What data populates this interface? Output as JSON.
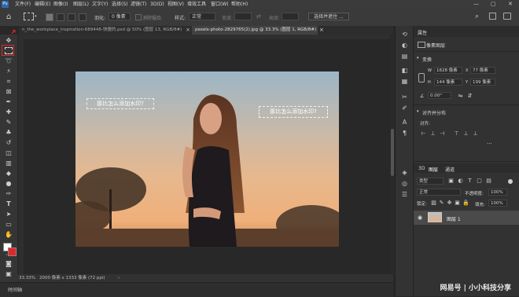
{
  "app": {
    "logo": "Ps"
  },
  "menu": [
    "文件(F)",
    "编辑(E)",
    "图像(I)",
    "图层(L)",
    "文字(Y)",
    "选择(S)",
    "滤镜(T)",
    "3D(D)",
    "视图(V)",
    "增效工具",
    "窗口(W)",
    "帮助(H)"
  ],
  "window_controls": {
    "minimize": "—",
    "maximize": "▢",
    "close": "✕"
  },
  "options": {
    "feather_label": "羽化:",
    "feather_value": "0 像素",
    "antialias_label": "消除锯齿",
    "style_label": "样式:",
    "style_value": "正常",
    "width_label": "宽度:",
    "height_label": "高度:",
    "select_mask_button": "选择并遮住 ..."
  },
  "tabs": [
    {
      "label": "n_the_workplace_inspiration-689448-快捷的.psd @ 50% (图层 13, RGB/8#)",
      "active": false,
      "close": "×"
    },
    {
      "label": "pexels-photo-2829765(2).jpg @ 33.3% (图层 1, RGB/8#)",
      "active": true,
      "close": "×"
    }
  ],
  "canvas": {
    "selection_text_1": "那比怎么添加水印?",
    "selection_text_2": "那比怎么添加水印?"
  },
  "status": {
    "zoom": "33.33%",
    "doc_info": "2000 像素 x 1333 像素 (72 ppi)",
    "arrow": "›"
  },
  "timeline": {
    "label": "时间轴"
  },
  "properties": {
    "panel_title": "属性",
    "pixel_layer_label": "像素图层",
    "transform_title": "变换",
    "w_label": "W",
    "w_value": "1828 像素",
    "x_label": "X",
    "x_value": "77 像素",
    "h_label": "H",
    "h_value": "144 像素",
    "y_label": "Y",
    "y_value": "199 像素",
    "angle_value": "0.00°",
    "align_title": "对齐并分布",
    "align_to_label": "对齐:"
  },
  "layers": {
    "tabs": [
      "3D",
      "图层",
      "通道"
    ],
    "filter_label": "类型",
    "blend_mode": "正常",
    "opacity_label": "不透明度:",
    "opacity_value": "100%",
    "lock_label": "锁定:",
    "fill_label": "填充:",
    "fill_value": "100%",
    "items": [
      {
        "name": "图层 1",
        "visible": true
      }
    ]
  },
  "watermark": "网易号 | 小小科技分享",
  "colors": {
    "accent": "#2f6aa8",
    "highlight": "#e0262b",
    "panel": "#323232"
  }
}
